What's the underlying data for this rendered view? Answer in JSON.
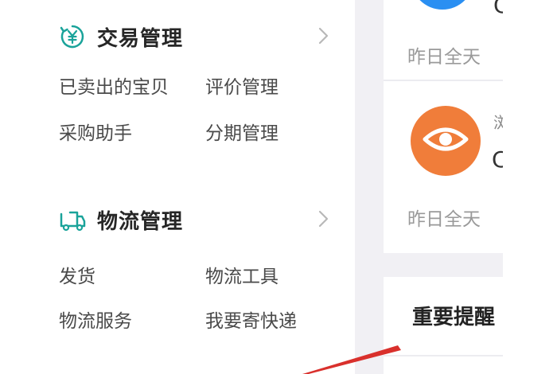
{
  "sidebar": {
    "trade": {
      "title": "交易管理",
      "icon": "yen-cycle-icon",
      "links": [
        "已卖出的宝贝",
        "评价管理",
        "采购助手",
        "分期管理"
      ]
    },
    "logistics": {
      "title": "物流管理",
      "icon": "truck-icon",
      "links": [
        "发货",
        "物流工具",
        "物流服务",
        "我要寄快递"
      ]
    }
  },
  "stats": {
    "card1_caption": "昨日全天",
    "card2_caption": "昨日全天",
    "card1_partial": "C",
    "card2_partial_label": "浏",
    "card2_partial_value": "C",
    "reminder_title": "重要提醒"
  },
  "colors": {
    "accent_teal": "#1aa39a",
    "blue_badge": "#2a8ff2",
    "orange_badge": "#f07d3a",
    "arrow_red": "#d9302c"
  }
}
